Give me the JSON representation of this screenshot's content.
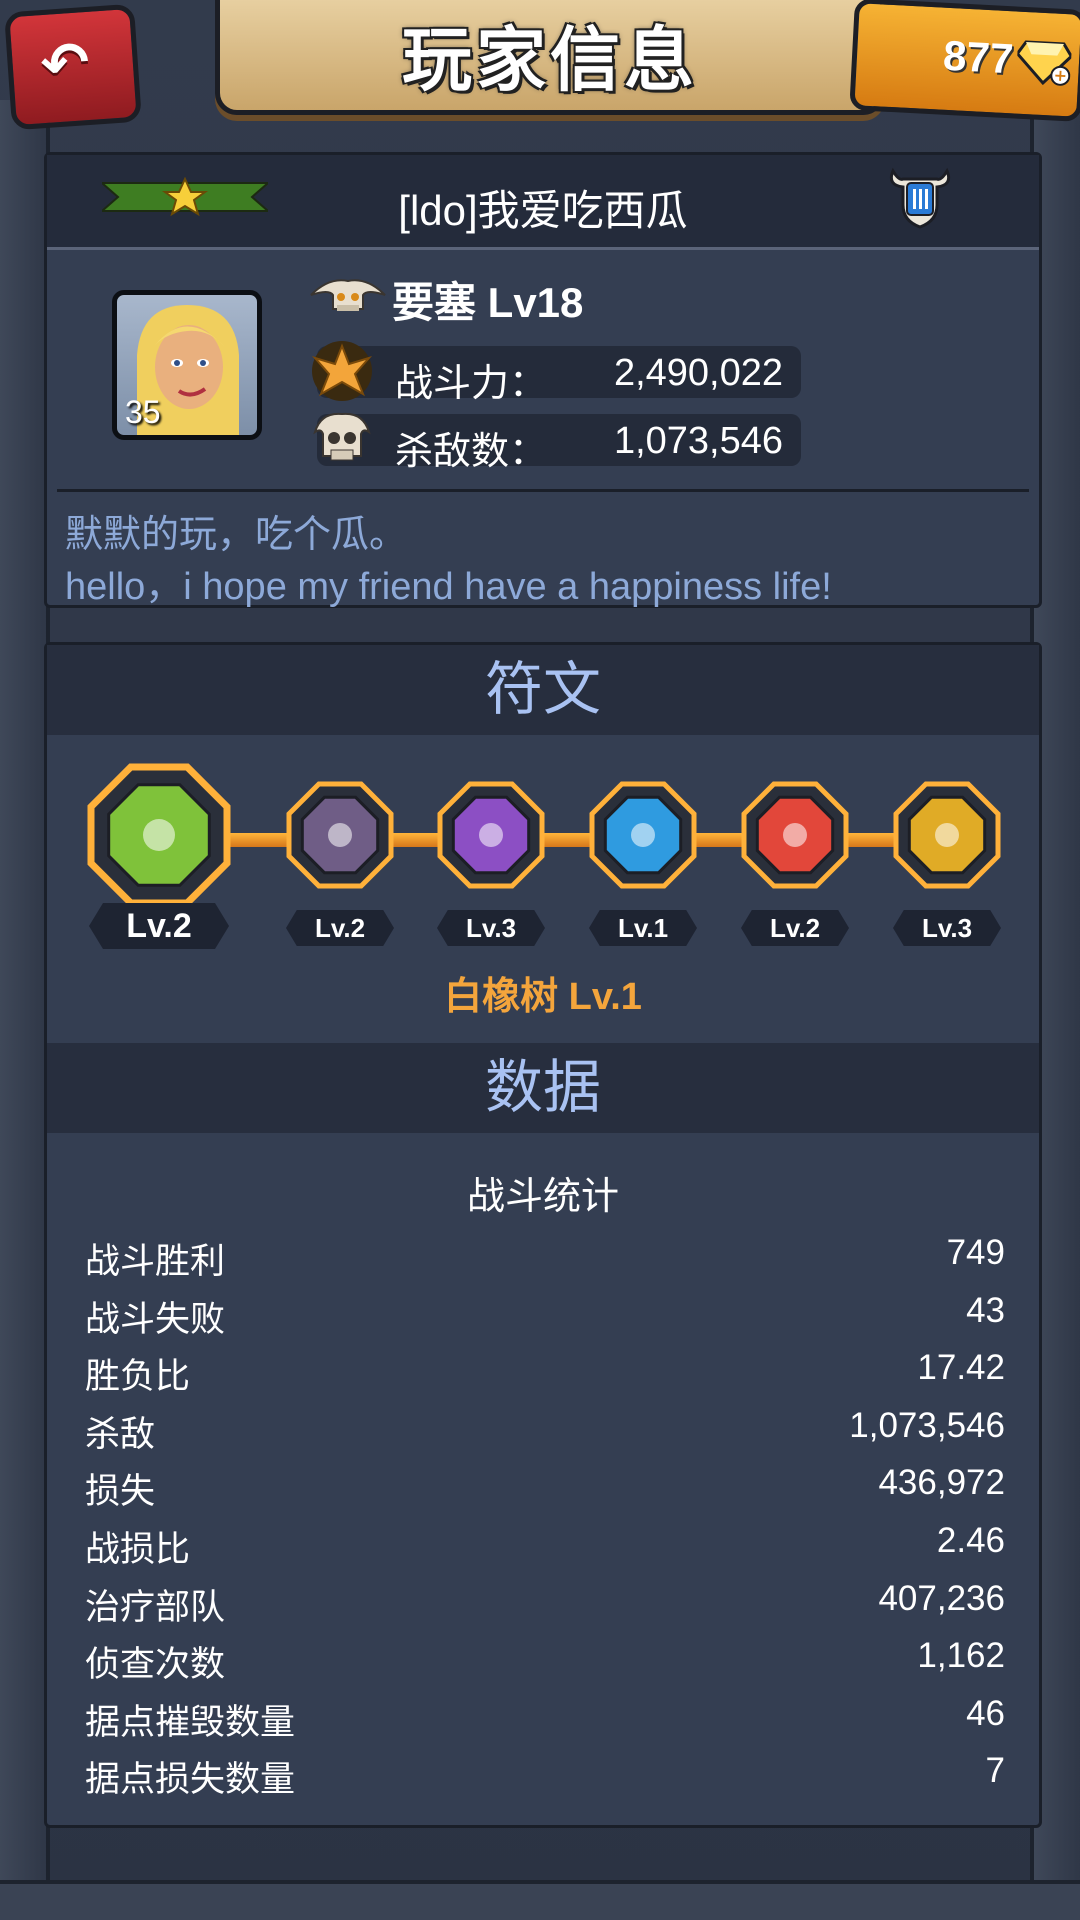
{
  "header": {
    "title": "玩家信息",
    "gems": "877"
  },
  "player": {
    "name": "[ldo]我爱吃西瓜",
    "avatar_level": "35",
    "fortress": "要塞 Lv18",
    "power_label": "战斗力：",
    "power_value": "2,490,022",
    "kills_label": "杀敌数：",
    "kills_value": "1,073,546",
    "motto_line1": "默默的玩，吃个瓜。",
    "motto_line2": "hello，i hope  my friend have a happiness life!"
  },
  "runes": {
    "section_title": "符文",
    "items": [
      {
        "level": "Lv.2",
        "color": "#7fc23a",
        "icon": "green-sun-rune-icon"
      },
      {
        "level": "Lv.2",
        "color": "#6f5d86",
        "icon": "purple-swirl-rune-icon"
      },
      {
        "level": "Lv.3",
        "color": "#8c4fc4",
        "icon": "purple-ring-rune-icon"
      },
      {
        "level": "Lv.1",
        "color": "#2f9be0",
        "icon": "blue-gear-rune-icon"
      },
      {
        "level": "Lv.2",
        "color": "#e2473a",
        "icon": "red-hammer-rune-icon"
      },
      {
        "level": "Lv.3",
        "color": "#e0ab26",
        "icon": "gold-star-rune-icon"
      }
    ],
    "selected_name": "白橡树 Lv.1"
  },
  "data": {
    "section_title": "数据",
    "stats_title": "战斗统计",
    "rows": [
      {
        "label": "战斗胜利",
        "value": "749"
      },
      {
        "label": "战斗失败",
        "value": "43"
      },
      {
        "label": "胜负比",
        "value": "17.42"
      },
      {
        "label": "杀敌",
        "value": "1,073,546"
      },
      {
        "label": "损失",
        "value": "436,972"
      },
      {
        "label": "战损比",
        "value": "2.46"
      },
      {
        "label": "治疗部队",
        "value": "407,236"
      },
      {
        "label": "侦查次数",
        "value": "1,162"
      },
      {
        "label": "据点摧毁数量",
        "value": "46"
      },
      {
        "label": "据点损失数量",
        "value": "7"
      }
    ]
  }
}
